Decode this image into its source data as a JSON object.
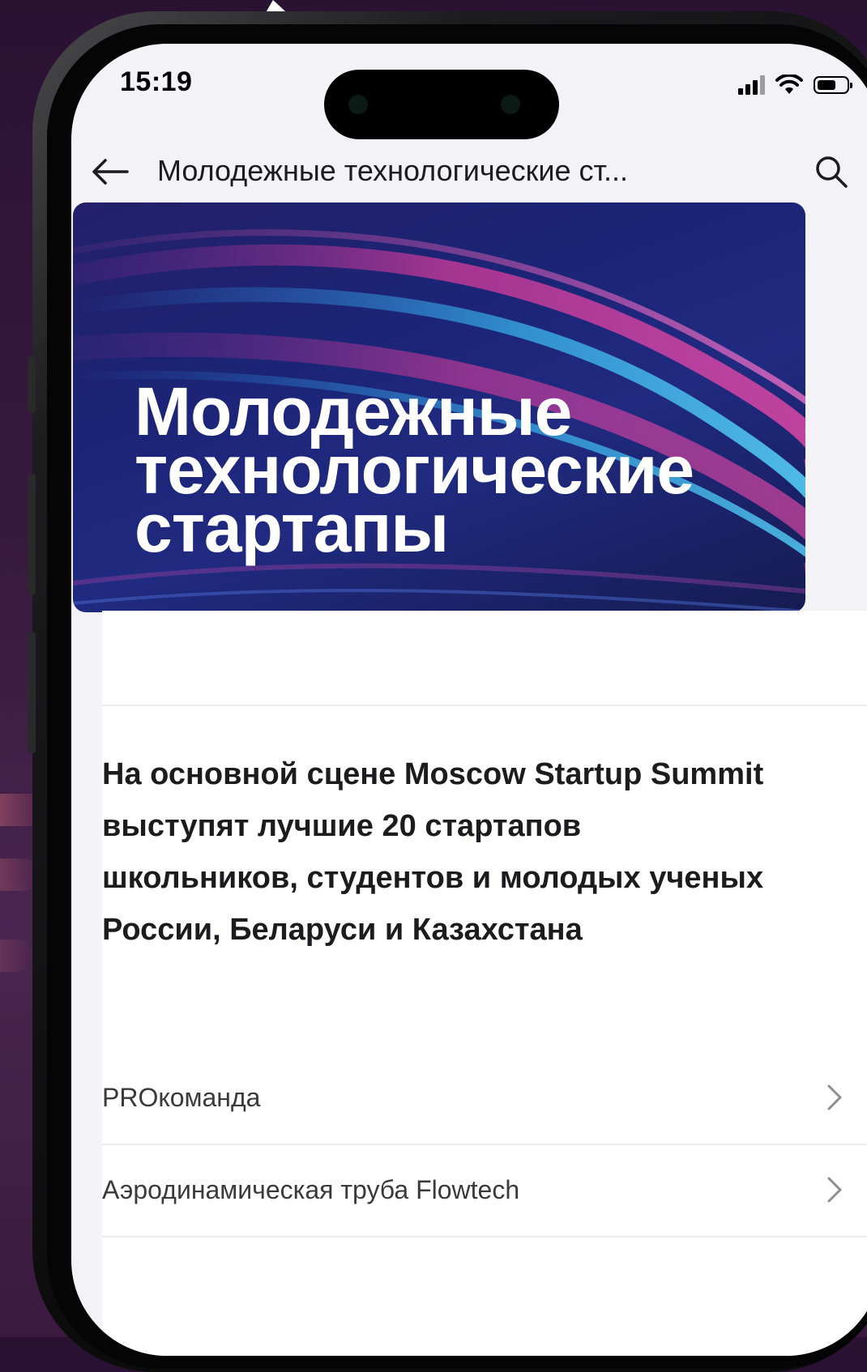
{
  "status_bar": {
    "time": "15:19"
  },
  "nav": {
    "title": "Молодежные технологические ст...",
    "back_icon": "arrow-left-icon",
    "search_icon": "search-icon"
  },
  "banner": {
    "title_lines": [
      "Молодежные",
      "технологические",
      "стартапы"
    ]
  },
  "content": {
    "lead_text": "На основной сцене Moscow Startup Summit выступят лучшие 20 стартапов школьников, студентов и молодых ученых России, Беларуси и Казахстана",
    "list": [
      {
        "label": "PROкоманда"
      },
      {
        "label": "Аэродинамическая труба Flowtech"
      }
    ]
  },
  "colors": {
    "banner_bg": "#1b2476",
    "text_primary": "#1c1c1e",
    "screen_bg": "#f2f2f7"
  }
}
